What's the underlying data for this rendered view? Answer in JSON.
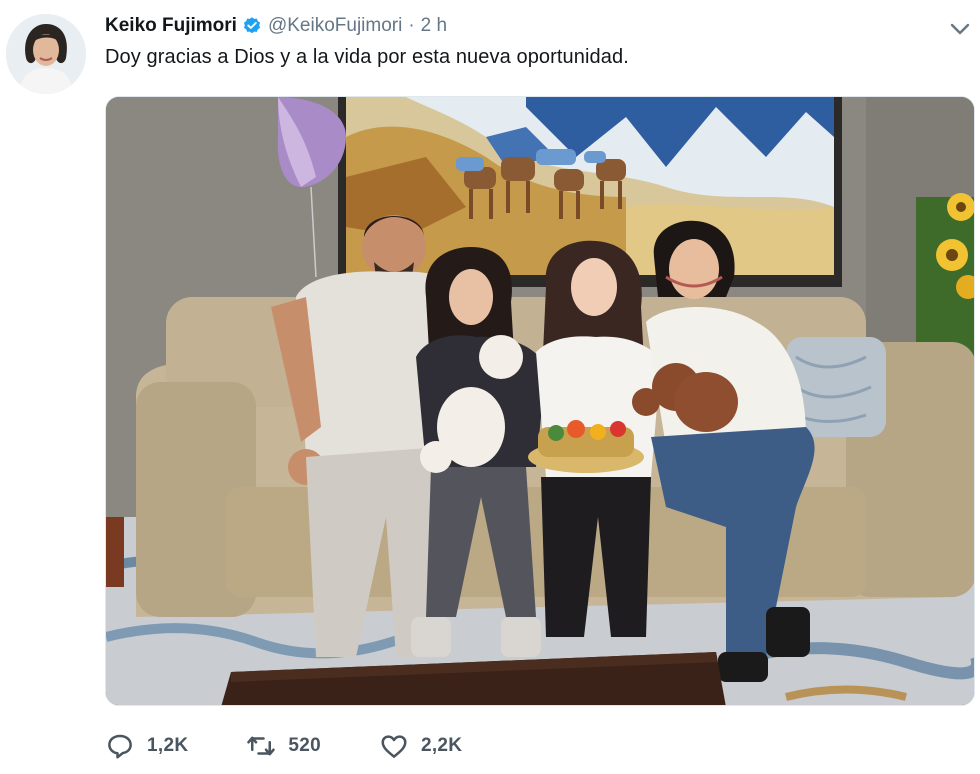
{
  "tweet": {
    "author": {
      "display_name": "Keiko Fujimori",
      "handle": "@KeikoFujimori",
      "verified": true,
      "avatar_icon": "profile-photo"
    },
    "separator": "·",
    "time": "2 h",
    "text": "Doy gracias a Dios y a la vida por esta nueva oportunidad.",
    "media": {
      "kind": "photo"
    },
    "actions": {
      "reply": {
        "icon": "reply-icon",
        "count": "1,2K"
      },
      "retweet": {
        "icon": "retweet-icon",
        "count": "520"
      },
      "like": {
        "icon": "heart-icon",
        "count": "2,2K"
      }
    },
    "menu_icon": "chevron-down-icon"
  },
  "colors": {
    "text_primary": "#14171a",
    "text_secondary": "#657786",
    "verified_blue": "#1da1f2",
    "action_gray": "#4a5560"
  }
}
